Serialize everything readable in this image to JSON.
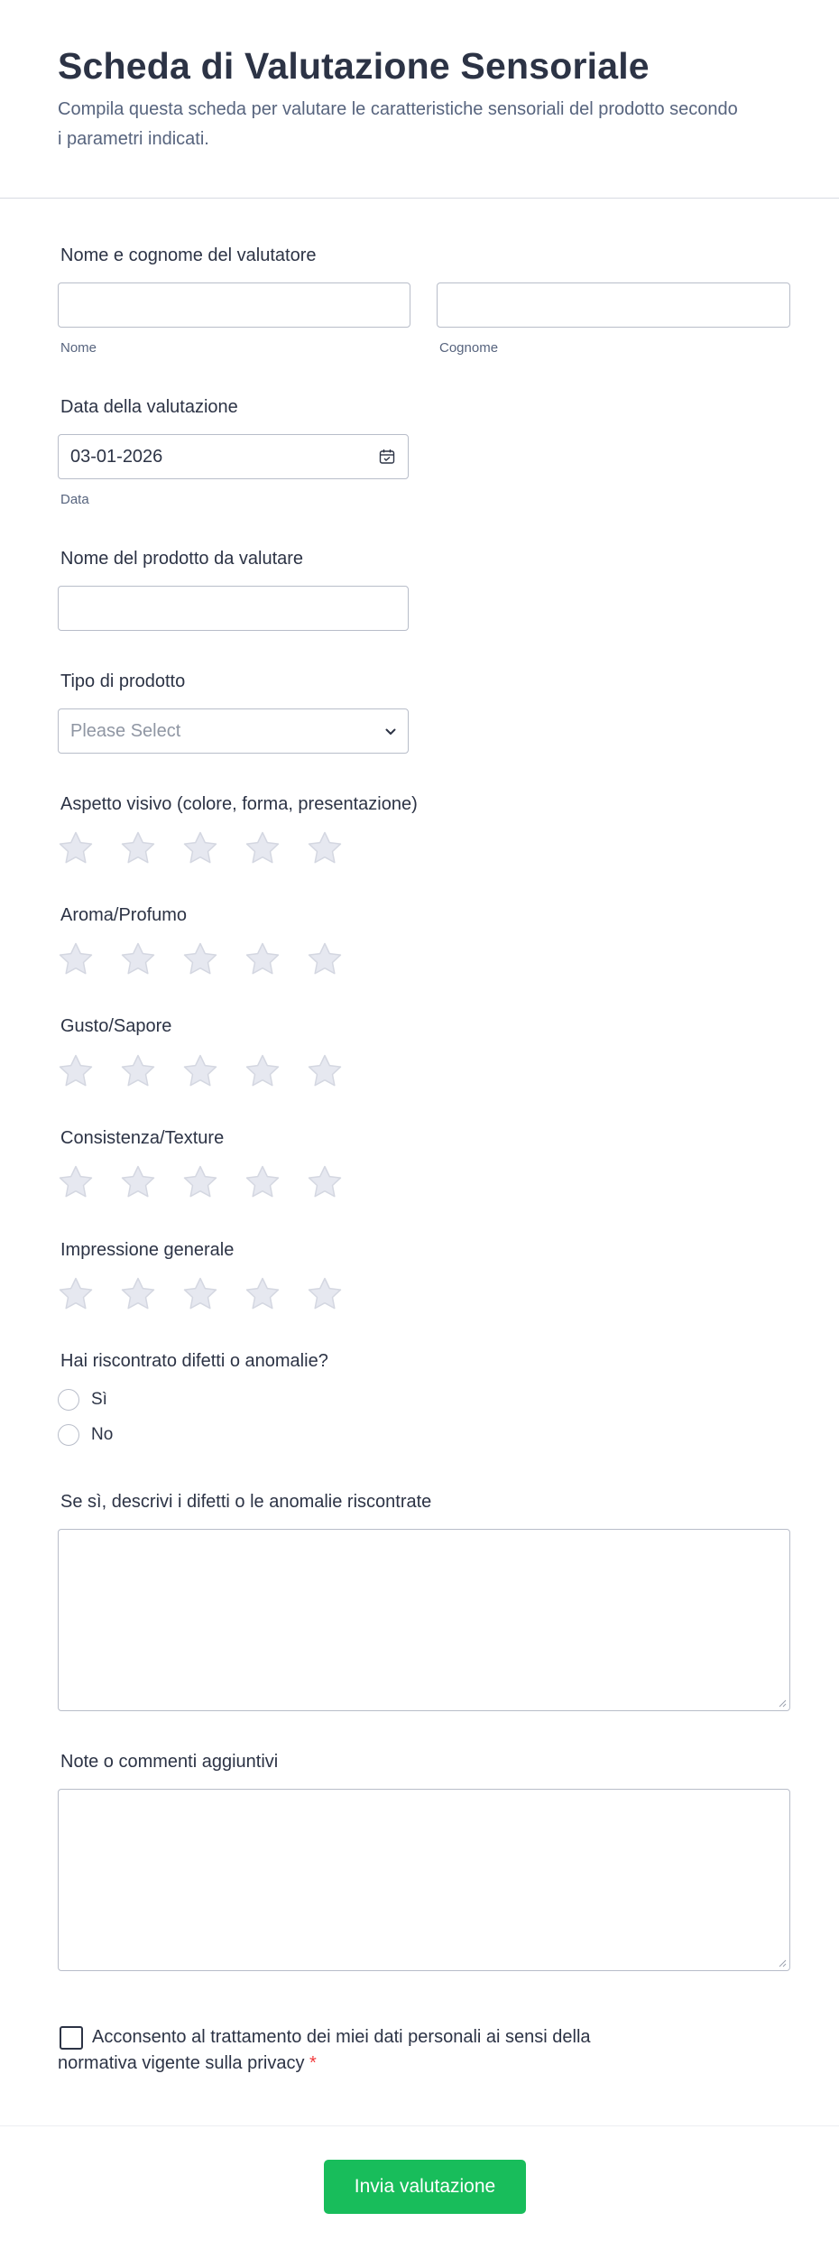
{
  "header": {
    "title": "Scheda di Valutazione Sensoriale",
    "subtitle": "Compila questa scheda per valutare le caratteristiche sensoriali del prodotto secondo i parametri indicati."
  },
  "evaluator": {
    "label": "Nome e cognome del valutatore",
    "first": {
      "value": "",
      "sublabel": "Nome"
    },
    "last": {
      "value": "",
      "sublabel": "Cognome"
    }
  },
  "date": {
    "label": "Data della valutazione",
    "value": "03-01-2026",
    "sublabel": "Data",
    "icon": "calendar-icon"
  },
  "product_name": {
    "label": "Nome del prodotto da valutare",
    "value": ""
  },
  "product_type": {
    "label": "Tipo di prodotto",
    "placeholder": "Please Select",
    "icon": "chevron-down-icon"
  },
  "ratings": [
    {
      "label": "Aspetto visivo (colore, forma, presentazione)",
      "value": 0,
      "max": 5
    },
    {
      "label": "Aroma/Profumo",
      "value": 0,
      "max": 5
    },
    {
      "label": "Gusto/Sapore",
      "value": 0,
      "max": 5
    },
    {
      "label": "Consistenza/Texture",
      "value": 0,
      "max": 5
    },
    {
      "label": "Impressione generale",
      "value": 0,
      "max": 5
    }
  ],
  "defects": {
    "label": "Hai riscontrato difetti o anomalie?",
    "options": [
      "Sì",
      "No"
    ]
  },
  "defects_description": {
    "label": "Se sì, descrivi i difetti o le anomalie riscontrate",
    "value": ""
  },
  "notes": {
    "label": "Note o commenti aggiuntivi",
    "value": ""
  },
  "consent": {
    "text": "Acconsento al trattamento dei miei dati personali ai sensi della normativa vigente sulla privacy",
    "required_mark": "*",
    "checked": false
  },
  "submit_label": "Invia valutazione",
  "colors": {
    "title": "#2c3345",
    "muted": "#57647e",
    "border": "#b8bdc9",
    "star_fill": "#e6e8f0",
    "star_stroke": "#d4d7e1",
    "submit": "#18bd5b",
    "required": "#f23a3c"
  }
}
